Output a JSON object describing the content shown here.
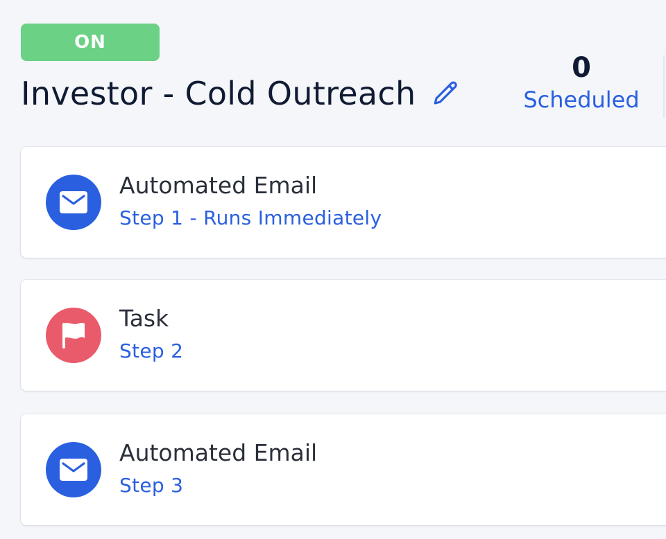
{
  "campaign": {
    "status": "ON",
    "title": "Investor - Cold Outreach",
    "edit_icon": "pencil-icon"
  },
  "stats": {
    "scheduled_value": "0",
    "scheduled_label": "Scheduled"
  },
  "steps": [
    {
      "type": "email",
      "icon": "envelope-icon",
      "name": "Automated Email",
      "detail": "Step 1 - Runs Immediately"
    },
    {
      "type": "task",
      "icon": "flag-icon",
      "name": "Task",
      "detail": "Step 2"
    },
    {
      "type": "email",
      "icon": "envelope-icon",
      "name": "Automated Email",
      "detail": "Step 3"
    }
  ],
  "colors": {
    "status_on": "#6bd185",
    "accent": "#2a5fe0",
    "task": "#e95b6b",
    "title": "#101b33"
  }
}
